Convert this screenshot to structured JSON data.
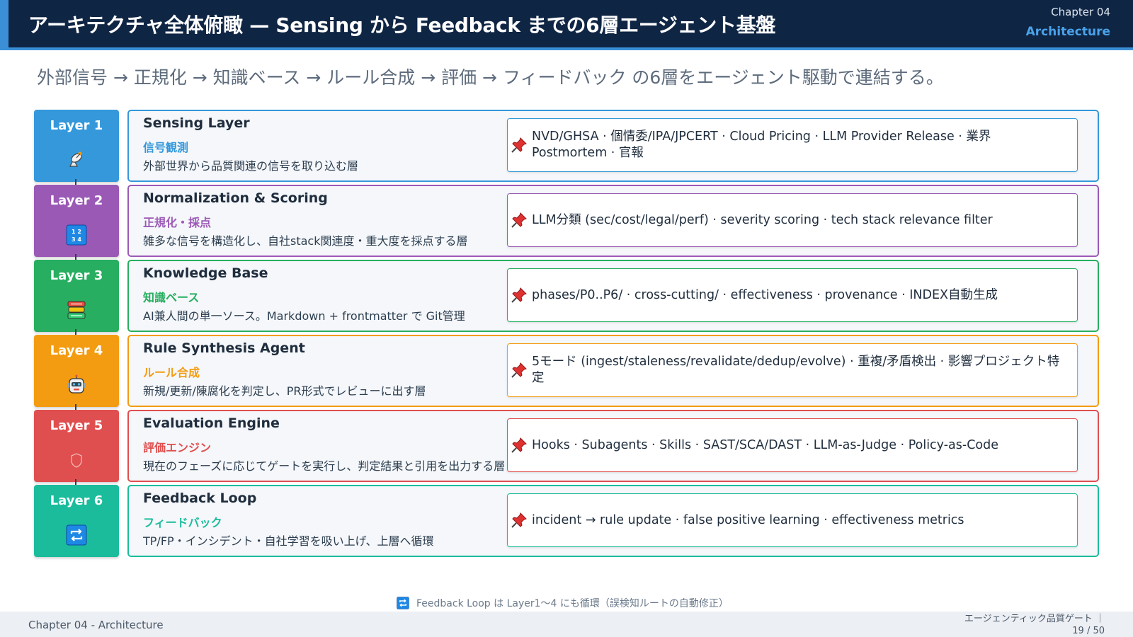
{
  "header": {
    "title": "アーキテクチャ全体俯瞰 — Sensing から Feedback までの6層エージェント基盤",
    "chapter_num": "Chapter 04",
    "chapter_name": "Architecture"
  },
  "subtitle": "外部信号 → 正規化 → 知識ベース → ルール合成 → 評価 → フィードバック の6層をエージェント駆動で連結する。",
  "layers": [
    {
      "label": "Layer 1",
      "color": "#3498db",
      "icon": "satellite-antenna-icon",
      "title": "Sensing Layer",
      "jp": "信号観測",
      "desc": "外部世界から品質関連の信号を取り込む層",
      "detail": "NVD/GHSA · 個情委/IPA/JPCERT · Cloud Pricing · LLM Provider Release · 業界 Postmortem · 官報"
    },
    {
      "label": "Layer 2",
      "color": "#9b59b6",
      "icon": "numbers-input-icon",
      "title": "Normalization & Scoring",
      "jp": "正規化・採点",
      "desc": "雑多な信号を構造化し、自社stack関連度・重大度を採点する層",
      "detail": "LLM分類 (sec/cost/legal/perf) · severity scoring · tech stack relevance filter"
    },
    {
      "label": "Layer 3",
      "color": "#27ae60",
      "icon": "books-icon",
      "title": "Knowledge Base",
      "jp": "知識ベース",
      "desc": "AI兼人間の単一ソース。Markdown + frontmatter で Git管理",
      "detail": "phases/P0..P6/ · cross-cutting/ · effectiveness · provenance · INDEX自動生成"
    },
    {
      "label": "Layer 4",
      "color": "#f39c12",
      "icon": "robot-icon",
      "title": "Rule Synthesis Agent",
      "jp": "ルール合成",
      "desc": "新規/更新/陳腐化を判定し、PR形式でレビューに出す層",
      "detail": "5モード (ingest/staleness/revalidate/dedup/evolve) · 重複/矛盾検出 · 影響プロジェクト特定"
    },
    {
      "label": "Layer 5",
      "color": "#e04f4f",
      "icon": "shield-icon",
      "title": "Evaluation Engine",
      "jp": "評価エンジン",
      "desc": "現在のフェーズに応じてゲートを実行し、判定結果と引用を出力する層",
      "detail": "Hooks · Subagents · Skills · SAST/SCA/DAST · LLM-as-Judge · Policy-as-Code"
    },
    {
      "label": "Layer 6",
      "color": "#1abc9c",
      "icon": "repeat-icon",
      "title": "Feedback Loop",
      "jp": "フィードバック",
      "desc": "TP/FP・インシデント・自社学習を吸い上げ、上層へ循環",
      "detail": "incident → rule update · false positive learning · effectiveness metrics"
    }
  ],
  "note": "Feedback Loop は Layer1〜4 にも循環（誤検知ルートの自動修正）",
  "footer": {
    "left": "Chapter 04 - Architecture",
    "right_title": "エージェンティック品質ゲート ｜",
    "page": "19 / 50"
  }
}
